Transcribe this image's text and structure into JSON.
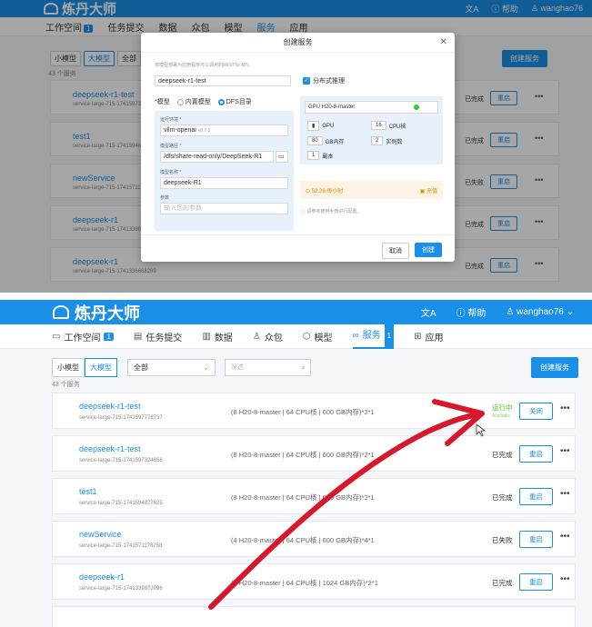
{
  "top": {
    "brand": "炼丹大师",
    "header_right": {
      "translate": "文A",
      "help": "帮助",
      "user": "wanghao76"
    },
    "nav": [
      {
        "label": "工作空间",
        "badge": "1"
      },
      {
        "label": "任务提交"
      },
      {
        "label": "数据"
      },
      {
        "label": "众包"
      },
      {
        "label": "模型"
      },
      {
        "label": "服务"
      },
      {
        "label": "应用"
      }
    ],
    "toolbar": {
      "small": "小模型",
      "large": "大模型",
      "all": "全部"
    },
    "create_label": "创建服务",
    "count": "43 个服务",
    "rows": [
      {
        "name": "deepseek-r1-test",
        "id": "service-large-715-17415973",
        "status": "已完成",
        "action": "重启"
      },
      {
        "name": "test1",
        "id": "service-large-715-17415948",
        "status": "已完成",
        "action": "重启"
      },
      {
        "name": "newService",
        "id": "service-large-715-17415711",
        "status": "已失败",
        "action": "重启"
      },
      {
        "name": "deepseek-r1",
        "id": "service-large-715-17413398",
        "status": "已完成",
        "action": "重启"
      },
      {
        "name": "deepseek-r1",
        "id": "service-large-715-1741336668289",
        "status": "已完成",
        "action": "重启"
      }
    ],
    "modal": {
      "title": "创建服务",
      "description": "将模型部署为应用程序可以调用的RESTful API。",
      "service_name": "deepseek-r1-test",
      "distributed_label": "分布式推理",
      "model_label": "模型",
      "builtin_label": "内置模型",
      "dfs_label": "DFS目录",
      "runtime_label": "运行环境",
      "runtime_value": "vllm-openai",
      "runtime_version": "v0.7.3",
      "model_path_label": "模型路径",
      "model_path": "/dfs/share-read-only/DeepSeek-R1",
      "model_name_label": "模型名称",
      "model_name": "deepseek-R1",
      "params_label": "参数",
      "params_placeholder": "输入您的参数",
      "gpu_select": "GPU H20-8-master",
      "gpu_label": "GPU",
      "cpu_value": "16",
      "cpu_label": "CPU核",
      "mem_value": "80",
      "mem_label": "GB内存",
      "instances_value": "2",
      "instances_label": "实例数",
      "replicas_value": "1",
      "replicas_label": "副本",
      "price": "52.28",
      "price_unit": "每小时",
      "recharge": "充值",
      "note": "请参考使用手册进行配置。",
      "cancel": "取消",
      "ok": "创建"
    }
  },
  "bottom": {
    "brand": "炼丹大师",
    "header_right": {
      "translate": "文A",
      "help": "帮助",
      "user": "wanghao76"
    },
    "nav": [
      {
        "label": "工作空间",
        "badge": "1"
      },
      {
        "label": "任务提交"
      },
      {
        "label": "数据"
      },
      {
        "label": "众包"
      },
      {
        "label": "模型"
      },
      {
        "label": "服务",
        "badge": "1"
      },
      {
        "label": "应用"
      }
    ],
    "toolbar": {
      "small": "小模型",
      "large": "大模型",
      "all": "全部",
      "filter_placeholder": "筛选"
    },
    "create_label": "创建服务",
    "count": "43 个服务",
    "rows": [
      {
        "name": "deepseek-r1-test",
        "id": "service-large-715-1741597778737",
        "spec": "(8 H20-8-master | 64 CPU核 | 600 GB内存)*2*1",
        "status": "运行中",
        "status_sub": "Available",
        "action": "关闭"
      },
      {
        "name": "deepseek-r1-test",
        "id": "service-large-715-1741597324858",
        "spec": "(8 H20-8-master | 64 CPU核 | 600 GB内存)*2*1",
        "status": "已完成",
        "action": "重启"
      },
      {
        "name": "test1",
        "id": "service-large-715-1741594877625",
        "spec": "(8 H20-8-master | 64 CPU核 | 600 GB内存)*2*1",
        "status": "已完成",
        "action": "重启"
      },
      {
        "name": "newService",
        "id": "service-large-715-1741571178758",
        "spec": "(4 H20-8-master | 64 CPU核 | 600 GB内存)*4*1",
        "status": "已失败",
        "action": "重启"
      },
      {
        "name": "deepseek-r1",
        "id": "service-large-715-1741339872096",
        "spec": "(8 H20-8-master | 64 CPU核 | 1024 GB内存)*2*1",
        "status": "已完成",
        "action": "重启"
      }
    ]
  },
  "colors": {
    "primary": "#1a8fe8",
    "running": "#52c41a",
    "annotation": "#d8172a"
  }
}
